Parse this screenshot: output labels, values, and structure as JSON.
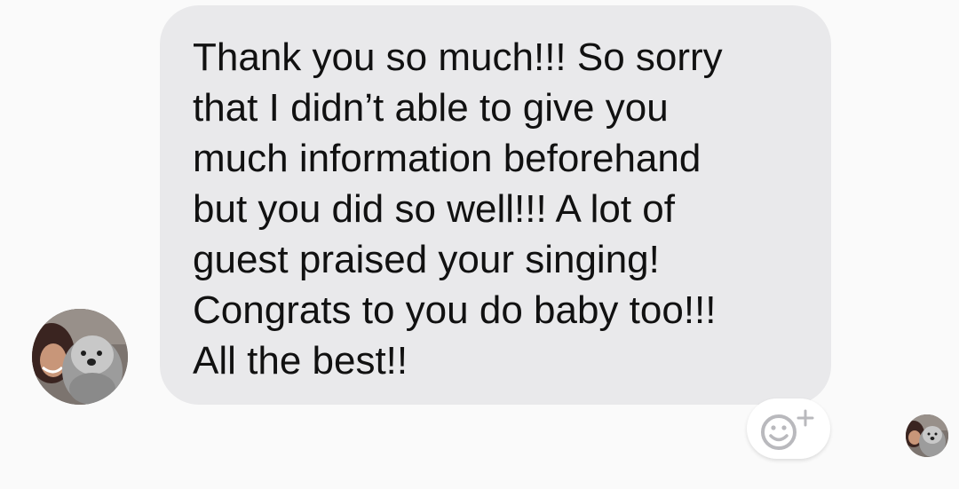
{
  "conversation": {
    "sender_avatar_icon": "profile-photo-woman-with-dog",
    "message_lines": [
      "Thank you so much!!! So sorry",
      "that I didn’t able to give you",
      "much information beforehand",
      "but you did so well!!! A lot of",
      "guest praised your singing!",
      "Congrats to you do baby too!!!",
      "All the best!!"
    ],
    "reaction_button_icon": "add-reaction-smiley-icon",
    "read_receipt_icon": "seen-avatar-icon"
  },
  "colors": {
    "background": "#fafafa",
    "bubble": "#e9e9eb",
    "text": "#111111",
    "reaction_icon": "#b9b9bd"
  }
}
